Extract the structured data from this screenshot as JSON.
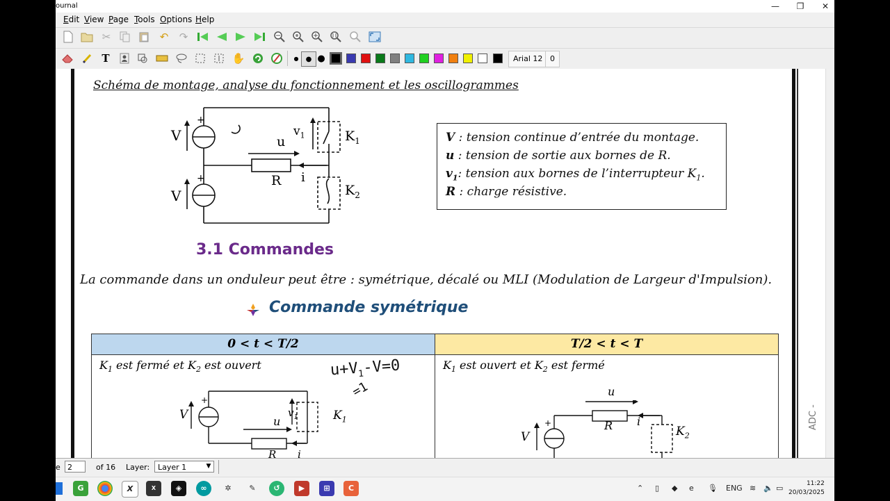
{
  "window": {
    "title_fragment": "ournal",
    "controls": [
      "—",
      "❐",
      "✕"
    ]
  },
  "menu": [
    "Edit",
    "View",
    "Page",
    "Tools",
    "Options",
    "Help"
  ],
  "toolbar2": {
    "colors": [
      "#000000",
      "#3a3ab0",
      "#e01010",
      "#0a7a1a",
      "#808080",
      "#30b8e0",
      "#20d020",
      "#e020e0",
      "#f08010",
      "#f0f000",
      "#ffffff",
      "#000000"
    ],
    "font_label": "Arial 12",
    "size_label": "0"
  },
  "document": {
    "heading": "Schéma de montage, analyse du fonctionnement et les oscillogrammes",
    "circuit": {
      "V": "V",
      "u": "u",
      "v1": "v",
      "v1_sub": "1",
      "R": "R",
      "i": "i",
      "K1": "K",
      "K1_sub": "1",
      "K2": "K",
      "K2_sub": "2",
      "plus": "+"
    },
    "legend": [
      {
        "key": "V",
        "text": ": tension continue d’entrée du montage."
      },
      {
        "key": "u",
        "text": ": tension de sortie aux bornes de R."
      },
      {
        "key": "v",
        "sub": "1",
        "text": ": tension aux bornes de l’interrupteur K",
        "tail_sub": "1",
        "tail": "."
      },
      {
        "key": "R",
        "text": ": charge résistive."
      }
    ],
    "section_title": "3.1  Commandes",
    "paragraph": "La commande dans un onduleur peut être : symétrique, décalé ou MLI (Modulation de Largeur d'Impulsion).",
    "subsection": "Commande symétrique",
    "table": {
      "col1_header": "0 < t < T/2",
      "col2_header": "T/2 < t < T",
      "col1_text": {
        "a": "K",
        "a_sub": "1",
        "b": " est fermé et K",
        "b_sub": "2",
        "c": " est ouvert"
      },
      "col2_text": {
        "a": "K",
        "a_sub": "1",
        "b": " est ouvert et K",
        "b_sub": "2",
        "c": " est fermé"
      }
    },
    "handwriting_line1": "u+V",
    "handwriting_sub": "1",
    "handwriting_line1_tail": "-V=0",
    "handwriting_line2": "=1",
    "side_text": "ADC -"
  },
  "status": {
    "page_label_fragment": "e",
    "page_number": "2",
    "of_pages": "of 16",
    "layer_label": "Layer:",
    "layer_value": "Layer 1"
  },
  "taskbar": {
    "lang": "ENG",
    "time": "11:22",
    "date": "20/03/2025"
  }
}
